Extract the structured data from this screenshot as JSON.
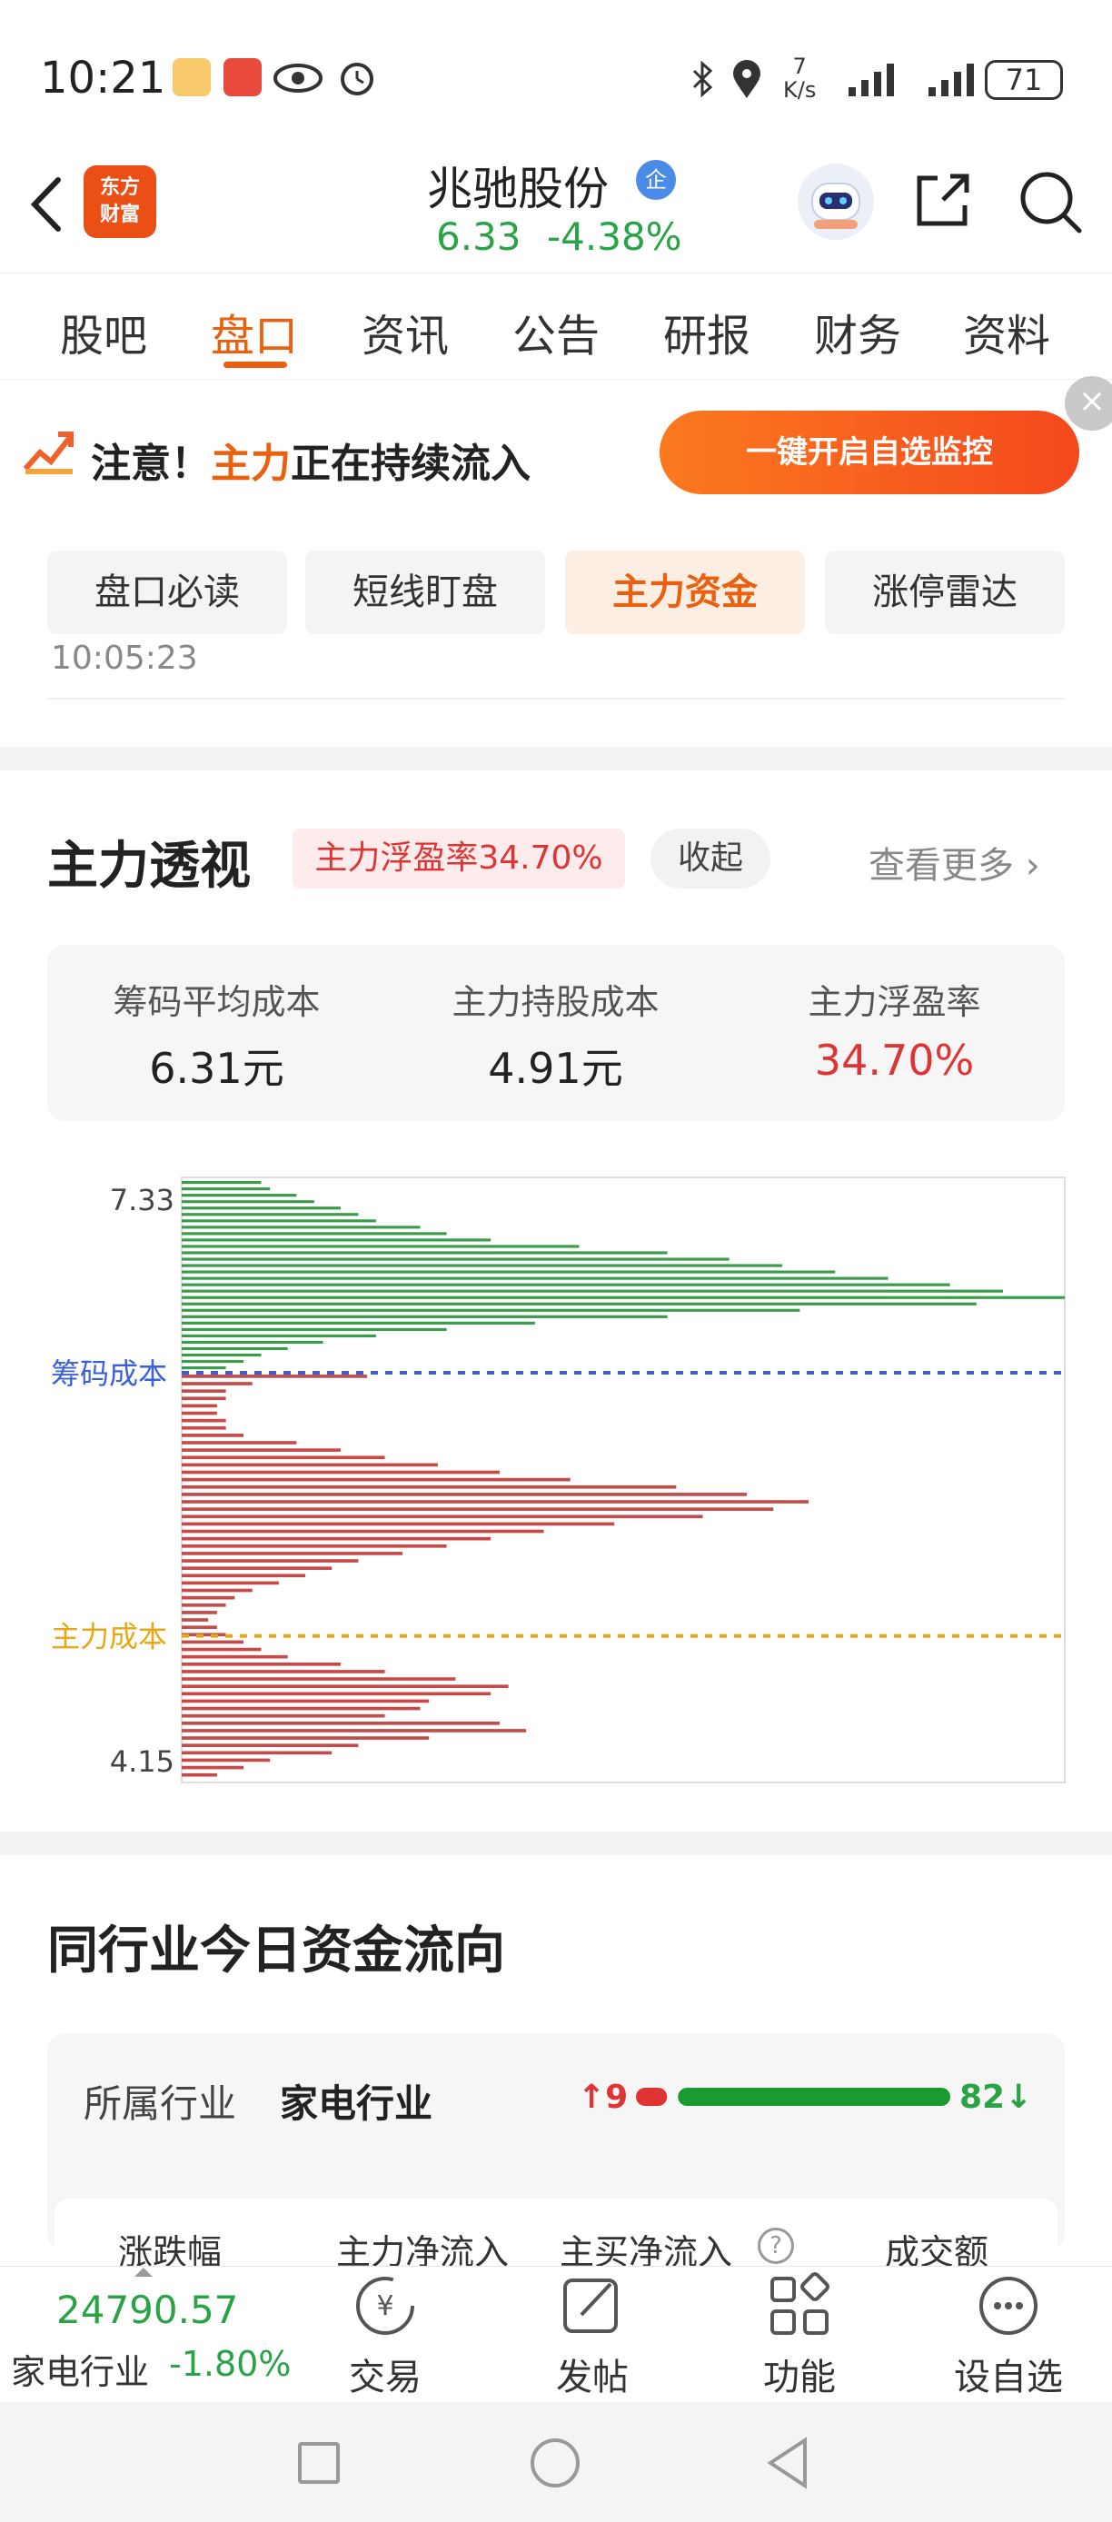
{
  "status_bar": {
    "time": "10:21",
    "net_speed": "7",
    "net_unit": "K/s",
    "battery": "71"
  },
  "header": {
    "logo_line1": "东方",
    "logo_line2": "财富",
    "stock_name": "兆驰股份",
    "badge": "企",
    "price": "6.33",
    "change": "-4.38%"
  },
  "tabs": [
    {
      "label": "股吧"
    },
    {
      "label": "盘口"
    },
    {
      "label": "资讯"
    },
    {
      "label": "公告"
    },
    {
      "label": "研报"
    },
    {
      "label": "财务"
    },
    {
      "label": "资料"
    }
  ],
  "banner": {
    "prefix": "注意！",
    "highlight": "主力",
    "suffix": "正在持续流入",
    "button": "一键开启自选监控",
    "close": "×"
  },
  "subtabs": [
    {
      "label": "盘口必读"
    },
    {
      "label": "短线盯盘"
    },
    {
      "label": "主力资金"
    },
    {
      "label": "涨停雷达"
    }
  ],
  "scroll_time": "10:05:23",
  "section": {
    "title": "主力透视",
    "ratio_badge": "主力浮盈率34.70%",
    "collapse": "收起",
    "more": "查看更多"
  },
  "stats": [
    {
      "label": "筹码平均成本",
      "value": "6.31元"
    },
    {
      "label": "主力持股成本",
      "value": "4.91元"
    },
    {
      "label": "主力浮盈率",
      "value": "34.70%"
    }
  ],
  "colors": {
    "accent": "#e9600e",
    "up": "#e03333",
    "down": "#2aa347",
    "chip_cost_line": "#3b5fd9",
    "main_cost_line": "#e6a817",
    "chip_above": "#3a9b4a",
    "chip_below": "#c64a4a"
  },
  "chart_data": {
    "type": "bar",
    "orientation": "horizontal",
    "description_fields": false,
    "y_top_label": "7.33",
    "y_bottom_label": "4.15",
    "ylim": [
      4.15,
      7.33
    ],
    "markers": [
      {
        "label": "筹码成本",
        "price": 6.31
      },
      {
        "label": "主力成本",
        "price": 4.91
      }
    ],
    "above_values": [
      0.09,
      0.1,
      0.13,
      0.15,
      0.18,
      0.2,
      0.22,
      0.27,
      0.3,
      0.35,
      0.45,
      0.55,
      0.62,
      0.68,
      0.74,
      0.8,
      0.87,
      0.93,
      1.0,
      0.9,
      0.7,
      0.55,
      0.4,
      0.3,
      0.22,
      0.16,
      0.12,
      0.09,
      0.07,
      0.05
    ],
    "below_values": [
      0.21,
      0.08,
      0.05,
      0.05,
      0.04,
      0.04,
      0.05,
      0.05,
      0.07,
      0.13,
      0.18,
      0.23,
      0.29,
      0.36,
      0.44,
      0.56,
      0.64,
      0.71,
      0.67,
      0.59,
      0.49,
      0.41,
      0.35,
      0.3,
      0.25,
      0.2,
      0.17,
      0.14,
      0.11,
      0.08,
      0.06,
      0.05,
      0.04,
      0.03,
      0.04,
      0.05,
      0.07,
      0.09,
      0.12,
      0.18,
      0.23,
      0.31,
      0.37,
      0.35,
      0.28,
      0.27,
      0.23,
      0.36,
      0.39,
      0.28,
      0.2,
      0.17,
      0.1,
      0.07,
      0.04
    ]
  },
  "industry": {
    "title": "同行业今日资金流向",
    "label": "所属行业",
    "name": "家电行业",
    "up_count": "9",
    "down_count": "82",
    "up_fraction": 0.099,
    "columns": [
      "涨跌幅",
      "主力净流入",
      "主买净流入",
      "成交额"
    ]
  },
  "bottom_bar": {
    "index_value": "24790.57",
    "index_name": "家电行业",
    "index_change": "-1.80%",
    "items": [
      {
        "label": "交易"
      },
      {
        "label": "发帖"
      },
      {
        "label": "功能"
      },
      {
        "label": "设自选"
      }
    ]
  }
}
